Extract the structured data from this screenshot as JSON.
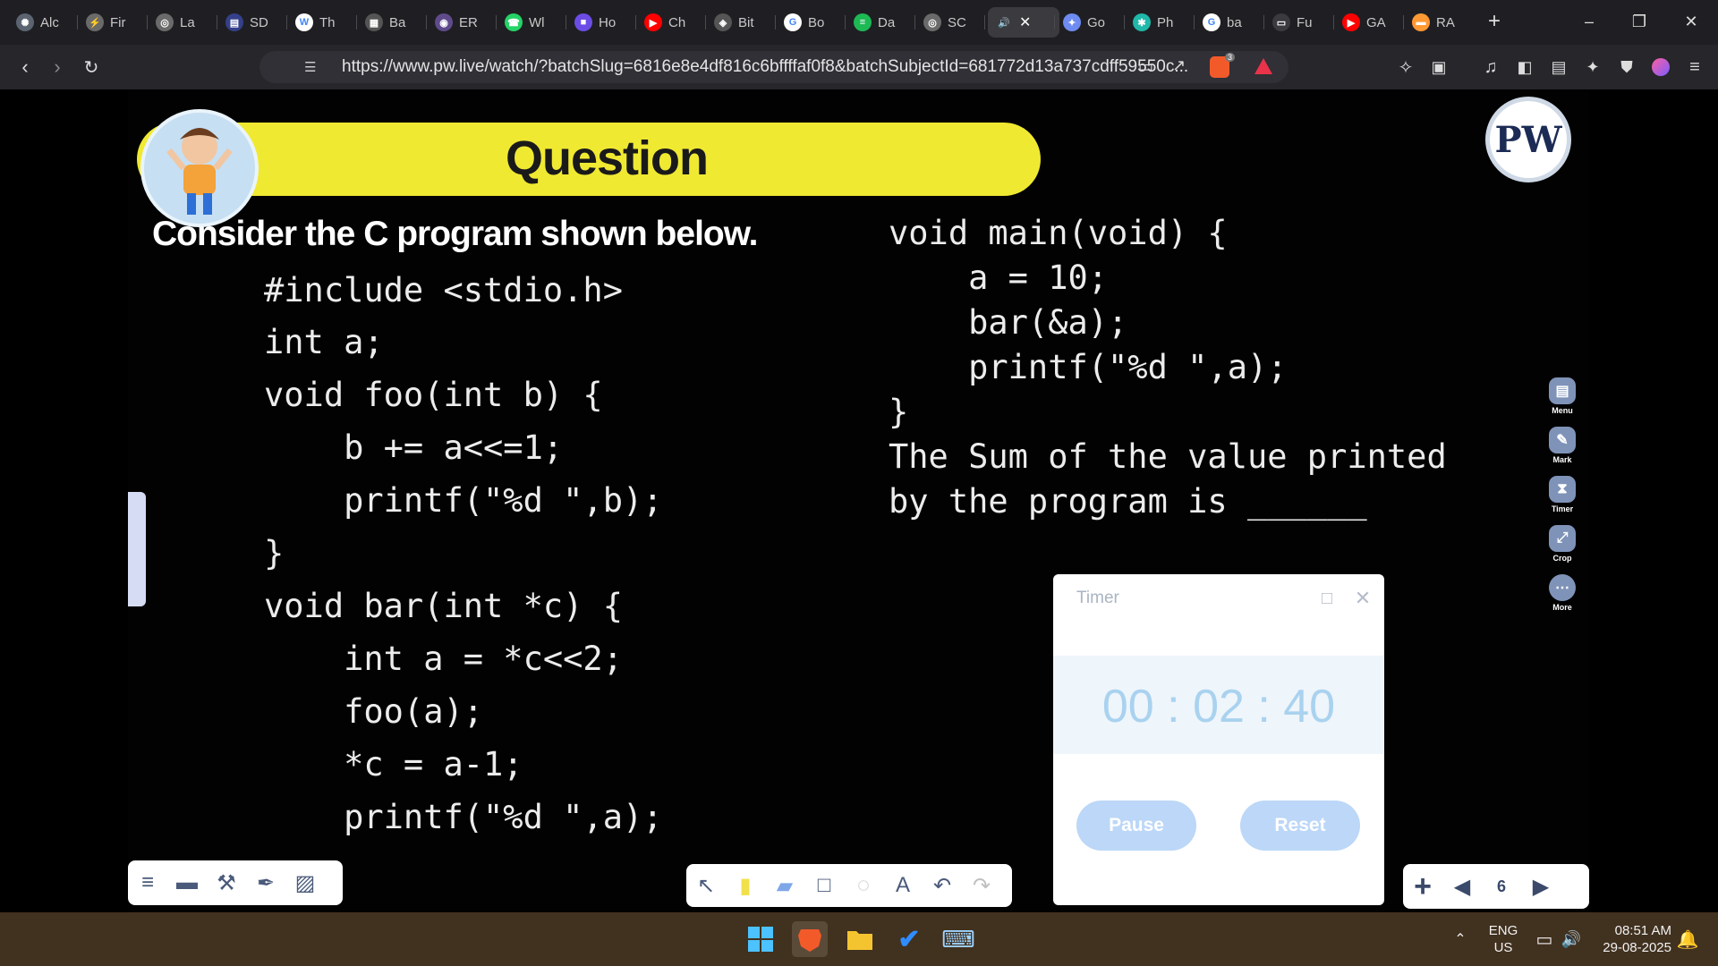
{
  "tabs": [
    {
      "label": "Alc",
      "icon": "chatgpt-icon",
      "color": "#5b6470"
    },
    {
      "label": "Fir",
      "icon": "bolt-icon",
      "color": "#6a6a6a"
    },
    {
      "label": "La",
      "icon": "globe-icon",
      "color": "#6a6a6a"
    },
    {
      "label": "SD",
      "icon": "doc-icon",
      "color": "#34408a"
    },
    {
      "label": "Th",
      "icon": "w3schools-icon",
      "color": "#ffffff"
    },
    {
      "label": "Ba",
      "icon": "grid-icon",
      "color": "#555555"
    },
    {
      "label": "ER",
      "icon": "erp-icon",
      "color": "#5f4b8b"
    },
    {
      "label": "Wl",
      "icon": "whatsapp-icon",
      "color": "#25d366"
    },
    {
      "label": "Ho",
      "icon": "book-icon",
      "color": "#6b4de6"
    },
    {
      "label": "Ch",
      "icon": "youtube-icon",
      "color": "#ff0000"
    },
    {
      "label": "Bit",
      "icon": "scaler-icon",
      "color": "#555555"
    },
    {
      "label": "Bo",
      "icon": "google-icon",
      "color": "#ffffff"
    },
    {
      "label": "Da",
      "icon": "spotify-icon",
      "color": "#1db954"
    },
    {
      "label": "SC",
      "icon": "globe-icon",
      "color": "#6a6a6a"
    },
    {
      "label": "",
      "icon": "speaker-icon",
      "color": "#3a3a3f",
      "active": true
    },
    {
      "label": "Go",
      "icon": "gemini-icon",
      "color": "#6d8bf0"
    },
    {
      "label": "Ph",
      "icon": "perplexity-icon",
      "color": "#20b8a8"
    },
    {
      "label": "ba",
      "icon": "google-icon",
      "color": "#ffffff"
    },
    {
      "label": "Fu",
      "icon": "monitor-icon",
      "color": "#3a3a3f"
    },
    {
      "label": "GA",
      "icon": "youtube-icon",
      "color": "#ff0000"
    },
    {
      "label": "RA",
      "icon": "india-flag-icon",
      "color": "#ff9933"
    }
  ],
  "browser": {
    "url": "https://www.pw.live/watch/?batchSlug=6816e8e4df816c6bffffaf0f8&batchSubjectId=681772d13a737cdff59550c...",
    "brave_badge": "3"
  },
  "slide": {
    "banner_title": "Question",
    "logo_text": "PW",
    "prompt": "Consider the C program shown below.",
    "code_left": [
      "#include <stdio.h>",
      "int a;",
      "void foo(int b) {",
      "    b += a<<=1;",
      "    printf(\"%d \",b);",
      "}",
      "void bar(int *c) {",
      "    int a = *c<<2;",
      "    foo(a);",
      "    *c = a-1;",
      "    printf(\"%d \",a);"
    ],
    "code_right": [
      "void main(void) {",
      "    a = 10;",
      "    bar(&a);",
      "    printf(\"%d \",a);",
      "}",
      "The Sum of the value printed",
      "by the program is ______"
    ],
    "side_tools": [
      "Menu",
      "Mark",
      "Timer",
      "Crop",
      "More"
    ],
    "page_number": "6"
  },
  "timer": {
    "title": "Timer",
    "display": "00 : 02 : 40",
    "pause_label": "Pause",
    "reset_label": "Reset"
  },
  "taskbar": {
    "language_line1": "ENG",
    "language_line2": "US",
    "time": "08:51 AM",
    "date": "29-08-2025"
  }
}
